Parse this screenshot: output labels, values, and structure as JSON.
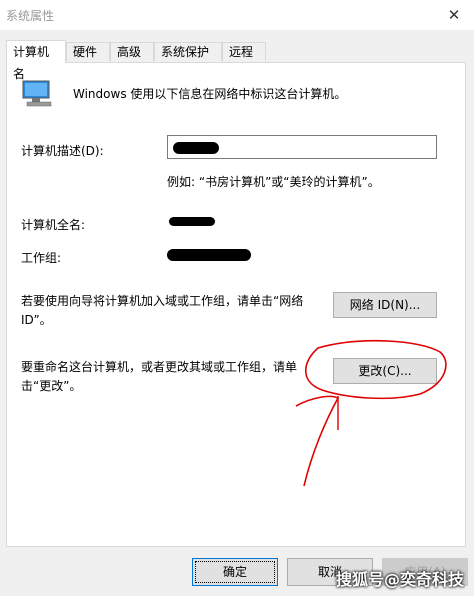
{
  "window": {
    "title": "系统属性",
    "close_label": "✕"
  },
  "tabs": [
    {
      "label": "计算机名",
      "active": true
    },
    {
      "label": "硬件",
      "active": false
    },
    {
      "label": "高级",
      "active": false
    },
    {
      "label": "系统保护",
      "active": false
    },
    {
      "label": "远程",
      "active": false
    }
  ],
  "panel": {
    "intro": "Windows 使用以下信息在网络中标识这台计算机。",
    "description_label": "计算机描述(D):",
    "description_value": "",
    "example": "例如: “书房计算机”或“美玲的计算机”。",
    "fullname_label": "计算机全名:",
    "workgroup_label": "工作组:",
    "network_text": "若要使用向导将计算机加入域或工作组，请单击“网络 ID”。",
    "network_button": "网络 ID(N)...",
    "rename_text": "要重命名这台计算机，或者更改其域或工作组，请单击“更改”。",
    "change_button": "更改(C)..."
  },
  "footer": {
    "ok": "确定",
    "cancel": "取消",
    "apply": "应用(A)"
  },
  "watermark": "搜狐号@奕奇科技",
  "icons": {
    "computer": "computer-icon",
    "close": "close-icon"
  },
  "colors": {
    "accent": "#0078d7",
    "annotation": "#e00000"
  }
}
